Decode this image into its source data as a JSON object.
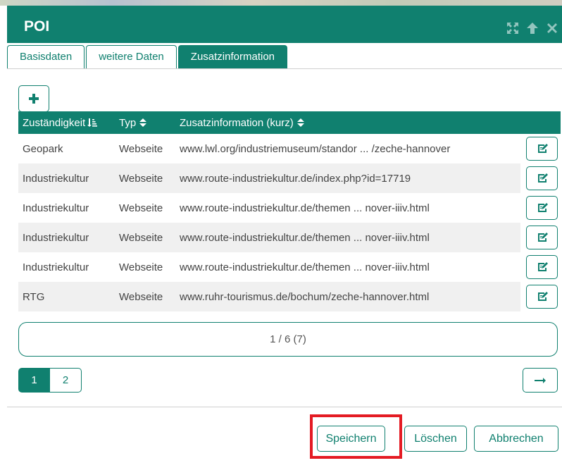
{
  "dialog": {
    "title": "POI",
    "title_icons": [
      "maximize-icon",
      "arrow-up-icon",
      "close-icon"
    ]
  },
  "tabs": [
    {
      "label": "Basisdaten",
      "active": false
    },
    {
      "label": "weitere Daten",
      "active": false
    },
    {
      "label": "Zusatzinformation",
      "active": true
    }
  ],
  "toolbar": {
    "add_label": "+"
  },
  "table": {
    "columns": [
      "Zuständigkeit",
      "Typ",
      "Zusatzinformation (kurz)"
    ],
    "sort_icons": [
      "sort-desc-icon",
      "sort-icon",
      "sort-icon"
    ],
    "rows": [
      {
        "zustaendigkeit": "Geopark",
        "typ": "Webseite",
        "info": "www.lwl.org/industriemuseum/standor ... /zeche-hannover"
      },
      {
        "zustaendigkeit": "Industriekultur",
        "typ": "Webseite",
        "info": "www.route-industriekultur.de/index.php?id=17719"
      },
      {
        "zustaendigkeit": "Industriekultur",
        "typ": "Webseite",
        "info": "www.route-industriekultur.de/themen ... nover-iiiv.html"
      },
      {
        "zustaendigkeit": "Industriekultur",
        "typ": "Webseite",
        "info": "www.route-industriekultur.de/themen ... nover-iiiv.html"
      },
      {
        "zustaendigkeit": "Industriekultur",
        "typ": "Webseite",
        "info": "www.route-industriekultur.de/themen ... nover-iiiv.html"
      },
      {
        "zustaendigkeit": "RTG",
        "typ": "Webseite",
        "info": "www.ruhr-tourismus.de/bochum/zeche-hannover.html"
      }
    ]
  },
  "pagination": {
    "summary": "1 / 6 (7)",
    "pages": [
      "1",
      "2"
    ],
    "active_page": "1"
  },
  "footer": {
    "save_label": "Speichern",
    "delete_label": "Löschen",
    "cancel_label": "Abbrechen"
  },
  "colors": {
    "accent": "#10806f",
    "highlight": "#e41b23"
  }
}
